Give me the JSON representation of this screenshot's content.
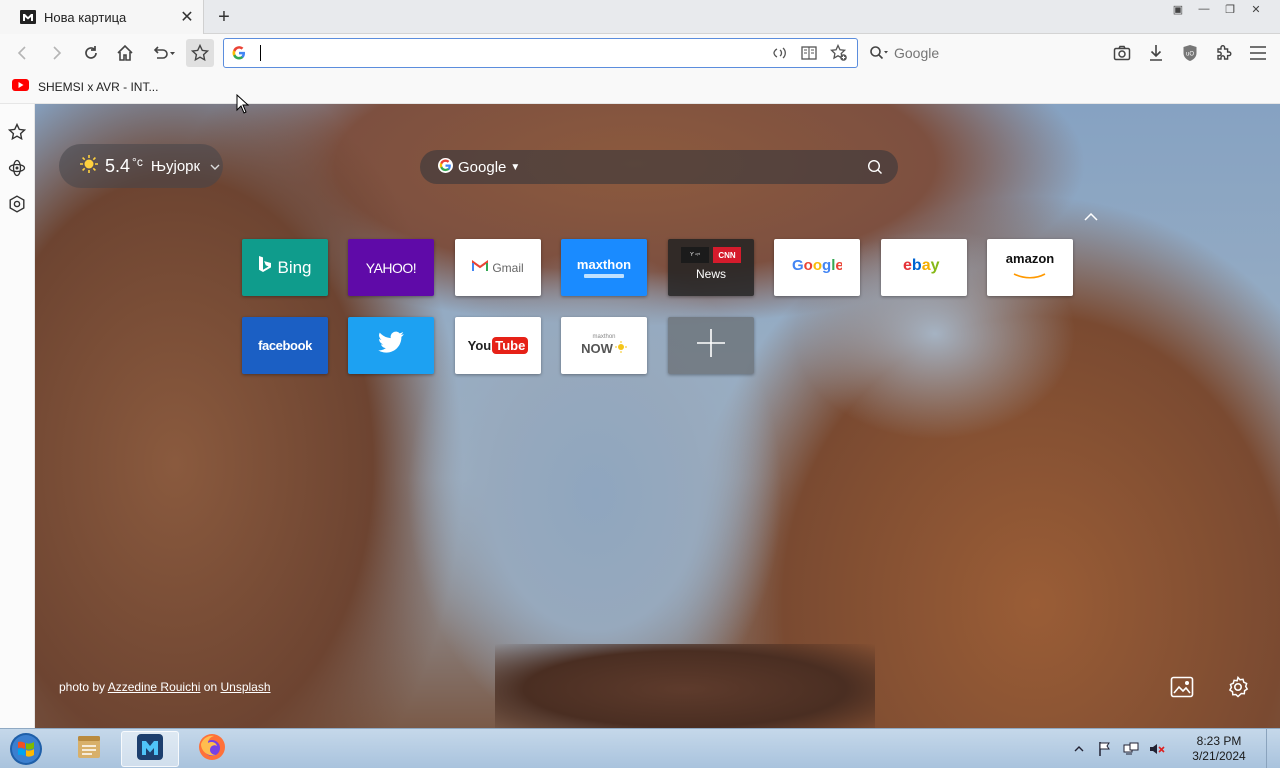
{
  "tab": {
    "title": "Нова картица",
    "close": "✕",
    "new": "+"
  },
  "window_controls": [
    "▣",
    "—",
    "❐",
    "✕"
  ],
  "address_bar": {
    "value": "",
    "placeholder": ""
  },
  "search_box": {
    "placeholder": "Google"
  },
  "bookmarks": [
    {
      "label": "SHEMSI x AVR - INT..."
    }
  ],
  "weather": {
    "temp": "5.4",
    "unit": "°c",
    "city": "Њујорк"
  },
  "ntp_search": {
    "engine": "Google",
    "placeholder": ""
  },
  "tiles": [
    {
      "id": "bing",
      "label": "Bing",
      "bg": "#0f9c8c",
      "color": "#ffffff"
    },
    {
      "id": "yahoo",
      "label": "YAHOO!",
      "bg": "#5f0aa8",
      "color": "#ffffff"
    },
    {
      "id": "gmail",
      "label": "Gmail",
      "bg": "#ffffff",
      "color": "#666666"
    },
    {
      "id": "maxthon",
      "label": "maxthon",
      "bg": "#1a8bff",
      "color": "#ffffff"
    },
    {
      "id": "news",
      "label": "News",
      "bg": "#2a2a2a",
      "color": "#ffffff"
    },
    {
      "id": "google",
      "label": "Google",
      "bg": "#ffffff",
      "color": "#4285f4"
    },
    {
      "id": "ebay",
      "label": "ebay",
      "bg": "#ffffff",
      "color": "#e53238"
    },
    {
      "id": "amazon",
      "label": "amazon",
      "bg": "#ffffff",
      "color": "#111111"
    },
    {
      "id": "facebook",
      "label": "facebook",
      "bg": "#1b5fc4",
      "color": "#ffffff"
    },
    {
      "id": "twitter",
      "label": "",
      "bg": "#1da1f2",
      "color": "#ffffff"
    },
    {
      "id": "youtube",
      "label": "YouTube",
      "bg": "#ffffff",
      "color": "#222222"
    },
    {
      "id": "maxthon-now",
      "label": "NOW",
      "bg": "#ffffff",
      "color": "#555555"
    },
    {
      "id": "add",
      "label": "+",
      "bg": "#6e767c",
      "color": "#ffffff"
    }
  ],
  "news_tile_sub": {
    "cnn": "CNN"
  },
  "photo_credit": {
    "prefix": "photo by",
    "author": "Azzedine Rouichi",
    "on": "on",
    "site": "Unsplash"
  },
  "taskbar": {
    "time": "8:23 PM",
    "date": "3/21/2024"
  },
  "colors": {
    "accent": "#5b8ddd",
    "taskbar": "#b6cde4"
  }
}
